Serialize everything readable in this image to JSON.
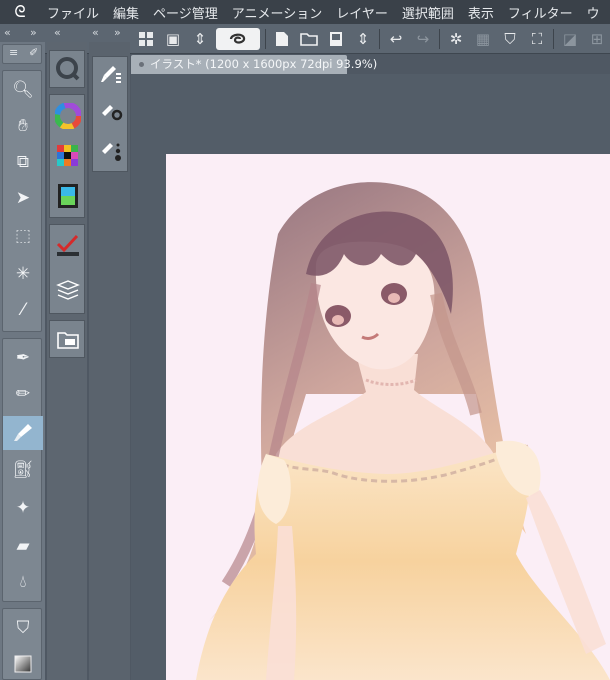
{
  "app": {
    "logo_glyph": "ᘓ"
  },
  "menubar": {
    "items": [
      "ファイル",
      "編集",
      "ページ管理",
      "アニメーション",
      "レイヤー",
      "選択範囲",
      "表示",
      "フィルター",
      "ウ"
    ]
  },
  "document": {
    "tab_title": "イラスト* (1200 x 1600px 72dpi 93.9%)"
  },
  "tools": {
    "groups": [
      {
        "name": "view-tools",
        "items": [
          "zoom-icon",
          "hand-icon",
          "move-icon",
          "operation-icon",
          "selection-icon",
          "auto-select-icon",
          "eyedropper-icon"
        ]
      },
      {
        "name": "drawing-tools",
        "items": [
          "pen-icon",
          "pencil-icon",
          "brush-icon",
          "airbrush-icon",
          "decoration-icon",
          "eraser-icon",
          "blend-icon"
        ]
      },
      {
        "name": "fill-tools",
        "items": [
          "fill-icon",
          "gradient-icon"
        ]
      }
    ],
    "active": "brush-icon"
  },
  "colors": {
    "menubar_bg": "#3a4149",
    "active_tool": "#93b5cf",
    "paper": "#fbeef6",
    "dress": "#f6d7a4",
    "hair": "#9c6f78"
  }
}
